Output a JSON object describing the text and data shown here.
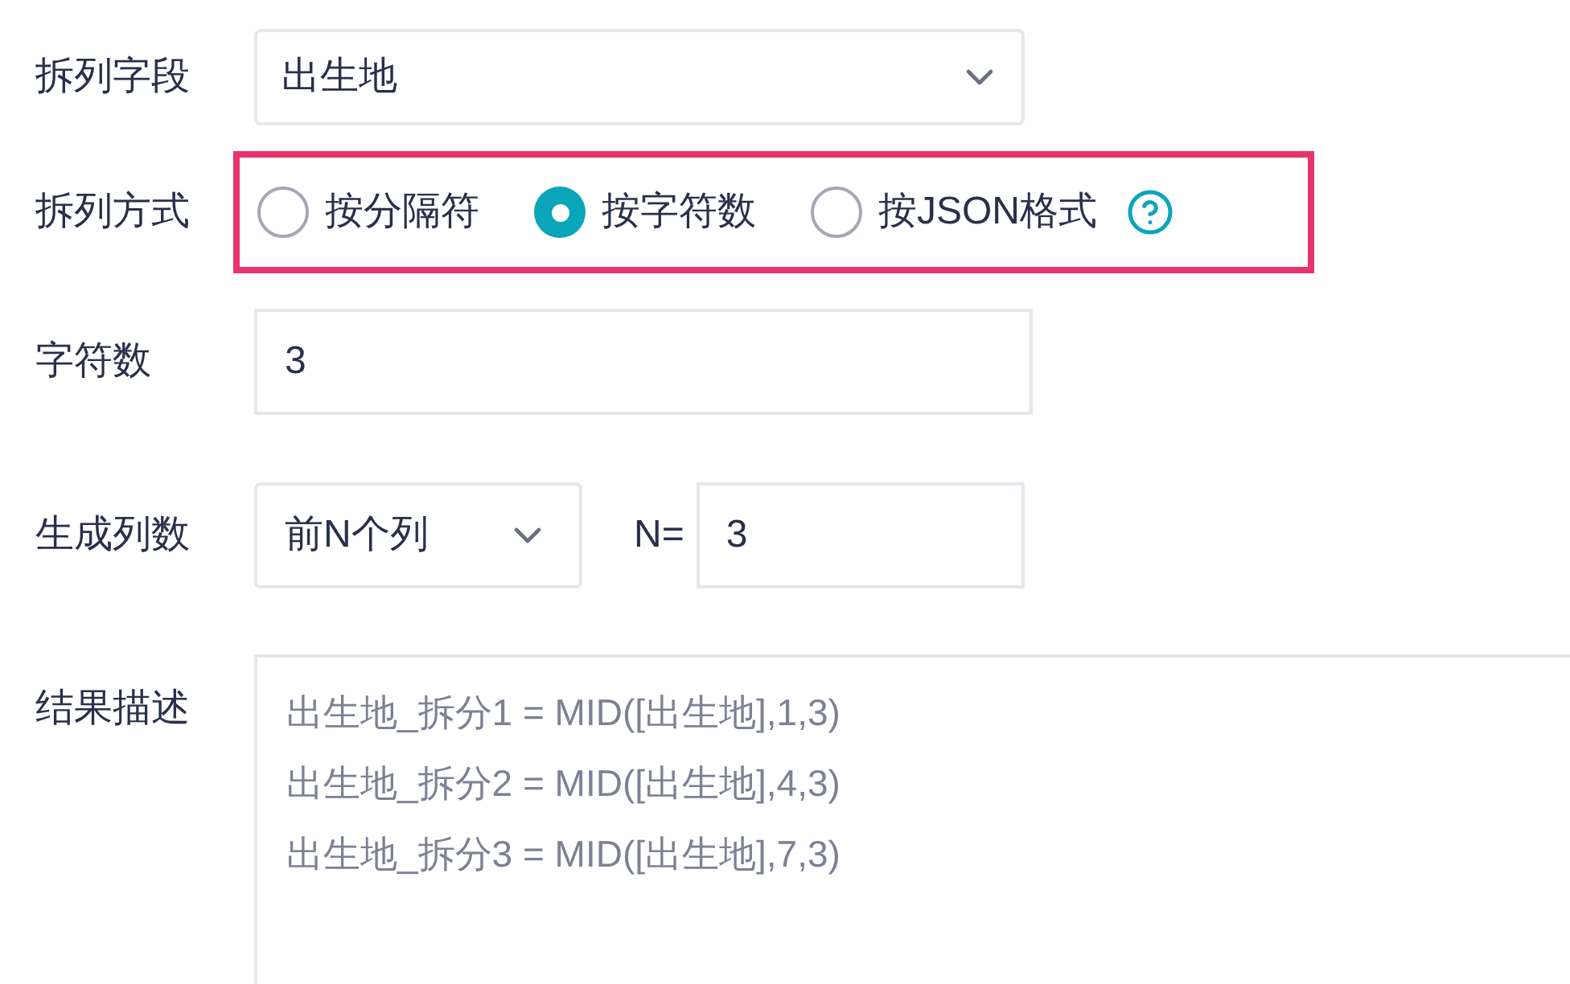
{
  "split_field": {
    "label": "拆列字段",
    "value": "出生地"
  },
  "split_method": {
    "label": "拆列方式",
    "highlighted": true,
    "options": [
      {
        "label": "按分隔符",
        "selected": false
      },
      {
        "label": "按字符数",
        "selected": true
      },
      {
        "label": "按JSON格式",
        "selected": false
      }
    ]
  },
  "char_count": {
    "label": "字符数",
    "value": "3"
  },
  "column_count": {
    "label": "生成列数",
    "value": "前N个列",
    "n_label": "N=",
    "n_value": "3"
  },
  "result_description": {
    "label": "结果描述",
    "lines": [
      "出生地_拆分1 = MID([出生地],1,3)",
      "出生地_拆分2 = MID([出生地],4,3)",
      "出生地_拆分3 = MID([出生地],7,3)"
    ]
  }
}
